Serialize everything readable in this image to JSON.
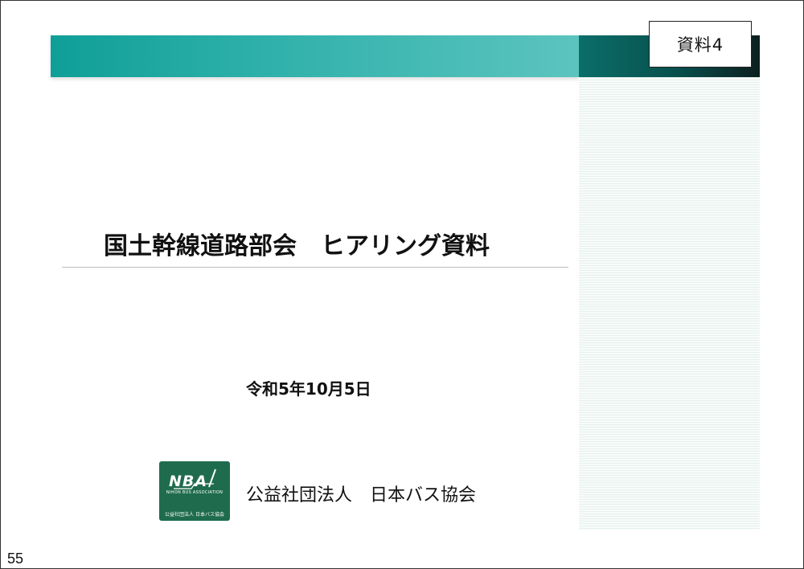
{
  "tag": "資料4",
  "title": "国土幹線道路部会　ヒアリング資料",
  "date": "令和5年10月5日",
  "logo": {
    "mark": "NBA",
    "tagline": "NIHON BUS ASSOCIATION",
    "footer": "公益社団法人 日本バス協会"
  },
  "organization": "公益社団法人　日本バス協会",
  "page_number": "55",
  "colors": {
    "teal": "#2fb0aa",
    "dark_teal": "#084f4c",
    "logo_green": "#1f6b4e"
  }
}
